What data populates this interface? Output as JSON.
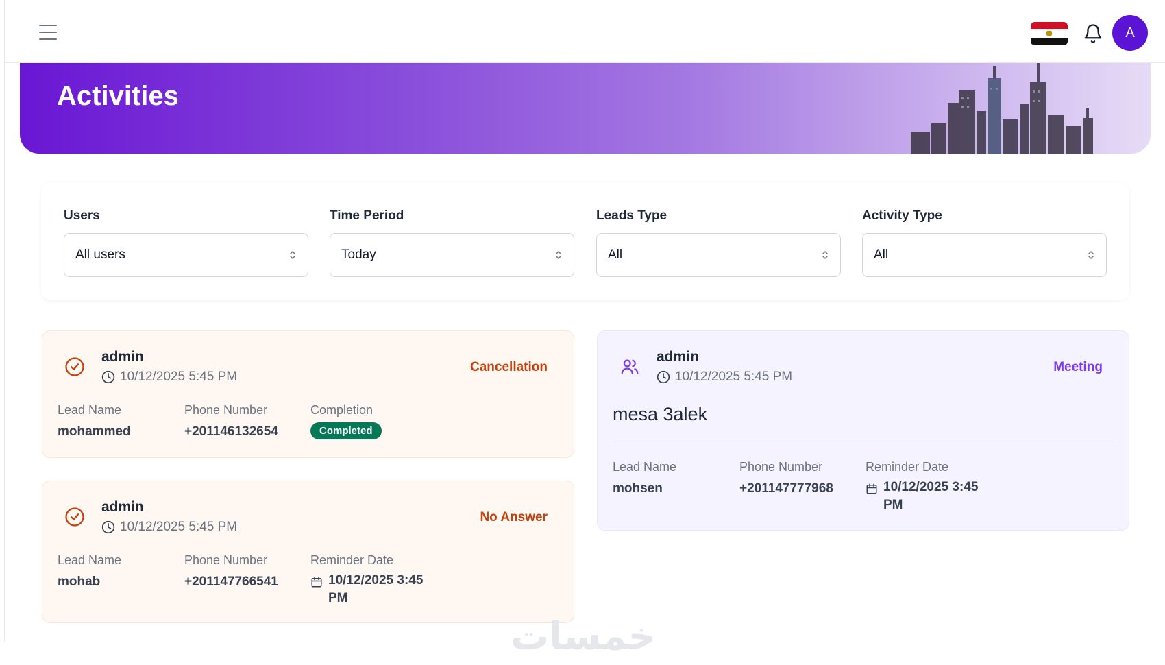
{
  "header": {
    "menu_icon": "hamburger-menu-icon",
    "flag_icon": "egypt-flag-icon",
    "bell_icon": "bell-icon",
    "avatar_initial": "A"
  },
  "banner": {
    "title": "Activities"
  },
  "filters": [
    {
      "label": "Users",
      "value": "All users"
    },
    {
      "label": "Time Period",
      "value": "Today"
    },
    {
      "label": "Leads Type",
      "value": "All"
    },
    {
      "label": "Activity Type",
      "value": "All"
    }
  ],
  "cards": {
    "cancellation": {
      "user": "admin",
      "time": "10/12/2025 5:45 PM",
      "type": "Cancellation",
      "lead_label": "Lead Name",
      "lead_value": "mohammed",
      "phone_label": "Phone Number",
      "phone_value": "+201146132654",
      "third_label": "Completion",
      "third_value": "Completed"
    },
    "no_answer": {
      "user": "admin",
      "time": "10/12/2025 5:45 PM",
      "type": "No Answer",
      "lead_label": "Lead Name",
      "lead_value": "mohab",
      "phone_label": "Phone Number",
      "phone_value": "+201147766541",
      "third_label": "Reminder Date",
      "third_value": "10/12/2025 3:45 PM"
    },
    "meeting": {
      "user": "admin",
      "time": "10/12/2025 5:45 PM",
      "type": "Meeting",
      "note": "mesa 3alek",
      "lead_label": "Lead Name",
      "lead_value": "mohsen",
      "phone_label": "Phone Number",
      "phone_value": "+201147777968",
      "third_label": "Reminder Date",
      "third_value": "10/12/2025 3:45 PM"
    }
  },
  "watermark": "خمسات",
  "colors": {
    "accent": "#5b14d6",
    "orange_text": "#c2410c",
    "purple_text": "#7c3aed",
    "badge_green": "#047857"
  }
}
